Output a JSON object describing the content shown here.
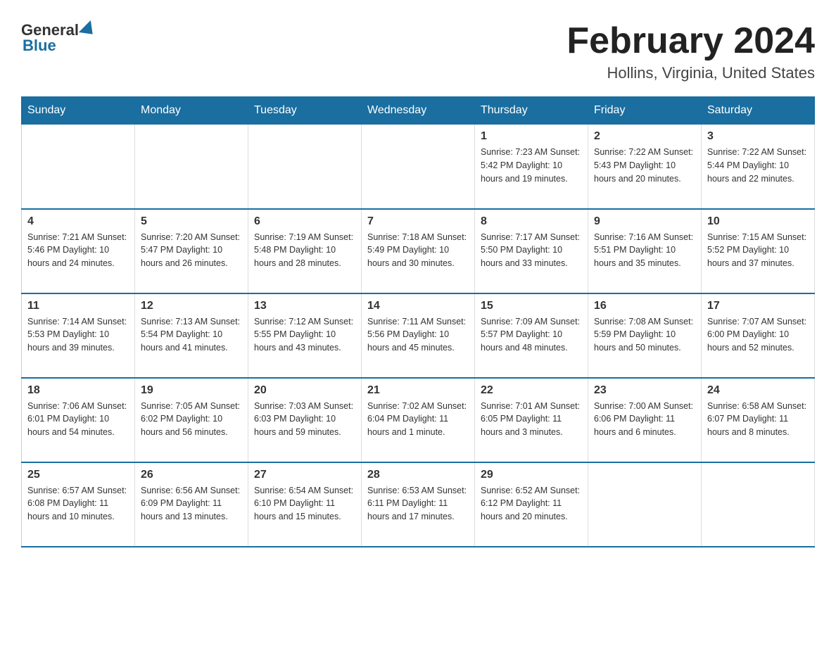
{
  "header": {
    "title": "February 2024",
    "location": "Hollins, Virginia, United States",
    "logo_general": "General",
    "logo_blue": "Blue"
  },
  "days_of_week": [
    "Sunday",
    "Monday",
    "Tuesday",
    "Wednesday",
    "Thursday",
    "Friday",
    "Saturday"
  ],
  "weeks": [
    [
      {
        "day": "",
        "info": ""
      },
      {
        "day": "",
        "info": ""
      },
      {
        "day": "",
        "info": ""
      },
      {
        "day": "",
        "info": ""
      },
      {
        "day": "1",
        "info": "Sunrise: 7:23 AM\nSunset: 5:42 PM\nDaylight: 10 hours and 19 minutes."
      },
      {
        "day": "2",
        "info": "Sunrise: 7:22 AM\nSunset: 5:43 PM\nDaylight: 10 hours and 20 minutes."
      },
      {
        "day": "3",
        "info": "Sunrise: 7:22 AM\nSunset: 5:44 PM\nDaylight: 10 hours and 22 minutes."
      }
    ],
    [
      {
        "day": "4",
        "info": "Sunrise: 7:21 AM\nSunset: 5:46 PM\nDaylight: 10 hours and 24 minutes."
      },
      {
        "day": "5",
        "info": "Sunrise: 7:20 AM\nSunset: 5:47 PM\nDaylight: 10 hours and 26 minutes."
      },
      {
        "day": "6",
        "info": "Sunrise: 7:19 AM\nSunset: 5:48 PM\nDaylight: 10 hours and 28 minutes."
      },
      {
        "day": "7",
        "info": "Sunrise: 7:18 AM\nSunset: 5:49 PM\nDaylight: 10 hours and 30 minutes."
      },
      {
        "day": "8",
        "info": "Sunrise: 7:17 AM\nSunset: 5:50 PM\nDaylight: 10 hours and 33 minutes."
      },
      {
        "day": "9",
        "info": "Sunrise: 7:16 AM\nSunset: 5:51 PM\nDaylight: 10 hours and 35 minutes."
      },
      {
        "day": "10",
        "info": "Sunrise: 7:15 AM\nSunset: 5:52 PM\nDaylight: 10 hours and 37 minutes."
      }
    ],
    [
      {
        "day": "11",
        "info": "Sunrise: 7:14 AM\nSunset: 5:53 PM\nDaylight: 10 hours and 39 minutes."
      },
      {
        "day": "12",
        "info": "Sunrise: 7:13 AM\nSunset: 5:54 PM\nDaylight: 10 hours and 41 minutes."
      },
      {
        "day": "13",
        "info": "Sunrise: 7:12 AM\nSunset: 5:55 PM\nDaylight: 10 hours and 43 minutes."
      },
      {
        "day": "14",
        "info": "Sunrise: 7:11 AM\nSunset: 5:56 PM\nDaylight: 10 hours and 45 minutes."
      },
      {
        "day": "15",
        "info": "Sunrise: 7:09 AM\nSunset: 5:57 PM\nDaylight: 10 hours and 48 minutes."
      },
      {
        "day": "16",
        "info": "Sunrise: 7:08 AM\nSunset: 5:59 PM\nDaylight: 10 hours and 50 minutes."
      },
      {
        "day": "17",
        "info": "Sunrise: 7:07 AM\nSunset: 6:00 PM\nDaylight: 10 hours and 52 minutes."
      }
    ],
    [
      {
        "day": "18",
        "info": "Sunrise: 7:06 AM\nSunset: 6:01 PM\nDaylight: 10 hours and 54 minutes."
      },
      {
        "day": "19",
        "info": "Sunrise: 7:05 AM\nSunset: 6:02 PM\nDaylight: 10 hours and 56 minutes."
      },
      {
        "day": "20",
        "info": "Sunrise: 7:03 AM\nSunset: 6:03 PM\nDaylight: 10 hours and 59 minutes."
      },
      {
        "day": "21",
        "info": "Sunrise: 7:02 AM\nSunset: 6:04 PM\nDaylight: 11 hours and 1 minute."
      },
      {
        "day": "22",
        "info": "Sunrise: 7:01 AM\nSunset: 6:05 PM\nDaylight: 11 hours and 3 minutes."
      },
      {
        "day": "23",
        "info": "Sunrise: 7:00 AM\nSunset: 6:06 PM\nDaylight: 11 hours and 6 minutes."
      },
      {
        "day": "24",
        "info": "Sunrise: 6:58 AM\nSunset: 6:07 PM\nDaylight: 11 hours and 8 minutes."
      }
    ],
    [
      {
        "day": "25",
        "info": "Sunrise: 6:57 AM\nSunset: 6:08 PM\nDaylight: 11 hours and 10 minutes."
      },
      {
        "day": "26",
        "info": "Sunrise: 6:56 AM\nSunset: 6:09 PM\nDaylight: 11 hours and 13 minutes."
      },
      {
        "day": "27",
        "info": "Sunrise: 6:54 AM\nSunset: 6:10 PM\nDaylight: 11 hours and 15 minutes."
      },
      {
        "day": "28",
        "info": "Sunrise: 6:53 AM\nSunset: 6:11 PM\nDaylight: 11 hours and 17 minutes."
      },
      {
        "day": "29",
        "info": "Sunrise: 6:52 AM\nSunset: 6:12 PM\nDaylight: 11 hours and 20 minutes."
      },
      {
        "day": "",
        "info": ""
      },
      {
        "day": "",
        "info": ""
      }
    ]
  ]
}
